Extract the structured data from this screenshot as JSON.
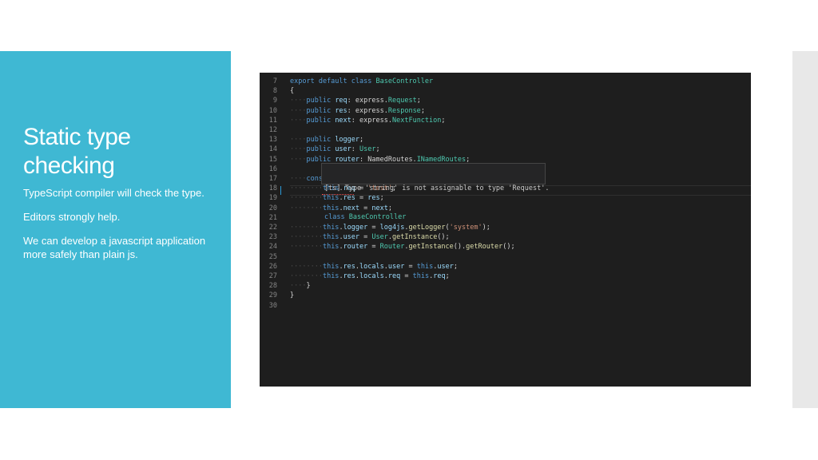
{
  "slide": {
    "title": "Static type checking",
    "bullets": [
      "TypeScript compiler will check the type.",
      "Editors strongly help.",
      "We can develop a javascript application more safely than plain js."
    ]
  },
  "editor": {
    "lines": [
      {
        "n": "7",
        "ws": "",
        "tokens": [
          [
            "kw",
            "export "
          ],
          [
            "kw",
            "default "
          ],
          [
            "kw",
            "class "
          ],
          [
            "cls",
            "BaseController"
          ]
        ]
      },
      {
        "n": "8",
        "ws": "",
        "tokens": [
          [
            "txt",
            "{"
          ]
        ]
      },
      {
        "n": "9",
        "ws": "····",
        "tokens": [
          [
            "kw",
            "public "
          ],
          [
            "prop",
            "req"
          ],
          [
            "txt",
            ": express."
          ],
          [
            "cls",
            "Request"
          ],
          [
            "txt",
            ";"
          ]
        ]
      },
      {
        "n": "10",
        "ws": "····",
        "tokens": [
          [
            "kw",
            "public "
          ],
          [
            "prop",
            "res"
          ],
          [
            "txt",
            ": express."
          ],
          [
            "cls",
            "Response"
          ],
          [
            "txt",
            ";"
          ]
        ]
      },
      {
        "n": "11",
        "ws": "····",
        "tokens": [
          [
            "kw",
            "public "
          ],
          [
            "prop",
            "next"
          ],
          [
            "txt",
            ": express."
          ],
          [
            "cls",
            "NextFunction"
          ],
          [
            "txt",
            ";"
          ]
        ]
      },
      {
        "n": "12",
        "ws": "",
        "tokens": []
      },
      {
        "n": "13",
        "ws": "····",
        "tokens": [
          [
            "kw",
            "public "
          ],
          [
            "prop",
            "logger"
          ],
          [
            "txt",
            ";"
          ]
        ]
      },
      {
        "n": "14",
        "ws": "····",
        "tokens": [
          [
            "kw",
            "public "
          ],
          [
            "prop",
            "user"
          ],
          [
            "txt",
            ": "
          ],
          [
            "cls",
            "User"
          ],
          [
            "txt",
            ";"
          ]
        ]
      },
      {
        "n": "15",
        "ws": "····",
        "tokens": [
          [
            "kw",
            "public "
          ],
          [
            "prop",
            "router"
          ],
          [
            "txt",
            ": NamedRoutes."
          ],
          [
            "cls",
            "INamedRoutes"
          ],
          [
            "txt",
            ";"
          ]
        ]
      },
      {
        "n": "16",
        "ws": "",
        "tokens": []
      },
      {
        "n": "17",
        "ws": "····",
        "tokens": [
          [
            "kw",
            "cons"
          ]
        ]
      },
      {
        "n": "18",
        "ws": "········",
        "tokens": [
          [
            "kw",
            "this"
          ],
          [
            "txt",
            "."
          ],
          [
            "prop",
            "req"
          ],
          [
            "txt",
            " = "
          ],
          [
            "str",
            "'test'"
          ],
          [
            "txt",
            ";"
          ]
        ]
      },
      {
        "n": "19",
        "ws": "········",
        "tokens": [
          [
            "kw",
            "this"
          ],
          [
            "txt",
            "."
          ],
          [
            "prop",
            "res"
          ],
          [
            "txt",
            " = "
          ],
          [
            "prop",
            "res"
          ],
          [
            "txt",
            ";"
          ]
        ]
      },
      {
        "n": "20",
        "ws": "········",
        "tokens": [
          [
            "kw",
            "this"
          ],
          [
            "txt",
            "."
          ],
          [
            "prop",
            "next"
          ],
          [
            "txt",
            " = "
          ],
          [
            "prop",
            "next"
          ],
          [
            "txt",
            ";"
          ]
        ]
      },
      {
        "n": "21",
        "ws": "",
        "tokens": []
      },
      {
        "n": "22",
        "ws": "········",
        "tokens": [
          [
            "kw",
            "this"
          ],
          [
            "txt",
            "."
          ],
          [
            "prop",
            "logger"
          ],
          [
            "txt",
            " = "
          ],
          [
            "prop",
            "log4js"
          ],
          [
            "txt",
            "."
          ],
          [
            "fn",
            "getLogger"
          ],
          [
            "txt",
            "("
          ],
          [
            "str",
            "'system'"
          ],
          [
            "txt",
            ");"
          ]
        ]
      },
      {
        "n": "23",
        "ws": "········",
        "tokens": [
          [
            "kw",
            "this"
          ],
          [
            "txt",
            "."
          ],
          [
            "prop",
            "user"
          ],
          [
            "txt",
            " = "
          ],
          [
            "cls",
            "User"
          ],
          [
            "txt",
            "."
          ],
          [
            "fn",
            "getInstance"
          ],
          [
            "txt",
            "();"
          ]
        ]
      },
      {
        "n": "24",
        "ws": "········",
        "tokens": [
          [
            "kw",
            "this"
          ],
          [
            "txt",
            "."
          ],
          [
            "prop",
            "router"
          ],
          [
            "txt",
            " = "
          ],
          [
            "cls",
            "Router"
          ],
          [
            "txt",
            "."
          ],
          [
            "fn",
            "getInstance"
          ],
          [
            "txt",
            "()."
          ],
          [
            "fn",
            "getRouter"
          ],
          [
            "txt",
            "();"
          ]
        ]
      },
      {
        "n": "25",
        "ws": "",
        "tokens": []
      },
      {
        "n": "26",
        "ws": "········",
        "tokens": [
          [
            "kw",
            "this"
          ],
          [
            "txt",
            "."
          ],
          [
            "prop",
            "res"
          ],
          [
            "txt",
            "."
          ],
          [
            "prop",
            "locals"
          ],
          [
            "txt",
            "."
          ],
          [
            "prop",
            "user"
          ],
          [
            "txt",
            " = "
          ],
          [
            "kw",
            "this"
          ],
          [
            "txt",
            "."
          ],
          [
            "prop",
            "user"
          ],
          [
            "txt",
            ";"
          ]
        ]
      },
      {
        "n": "27",
        "ws": "········",
        "tokens": [
          [
            "kw",
            "this"
          ],
          [
            "txt",
            "."
          ],
          [
            "prop",
            "res"
          ],
          [
            "txt",
            "."
          ],
          [
            "prop",
            "locals"
          ],
          [
            "txt",
            "."
          ],
          [
            "prop",
            "req"
          ],
          [
            "txt",
            " = "
          ],
          [
            "kw",
            "this"
          ],
          [
            "txt",
            "."
          ],
          [
            "prop",
            "req"
          ],
          [
            "txt",
            ";"
          ]
        ]
      },
      {
        "n": "28",
        "ws": "····",
        "tokens": [
          [
            "txt",
            "}"
          ]
        ]
      },
      {
        "n": "29",
        "ws": "",
        "tokens": [
          [
            "txt",
            "}"
          ]
        ]
      },
      {
        "n": "30",
        "ws": "",
        "tokens": []
      }
    ],
    "tooltip": {
      "line1": "[ts] Type 'string' is not assignable to type 'Request'.",
      "line2_kw": "class ",
      "line2_cls": "BaseController"
    }
  },
  "colors": {
    "panel": "#3fb8d3",
    "editor_bg": "#1e1e1e",
    "keyword": "#569cd6",
    "type": "#4ec9b0",
    "property": "#9cdcfe",
    "string": "#ce9178",
    "function": "#dcdcaa"
  }
}
